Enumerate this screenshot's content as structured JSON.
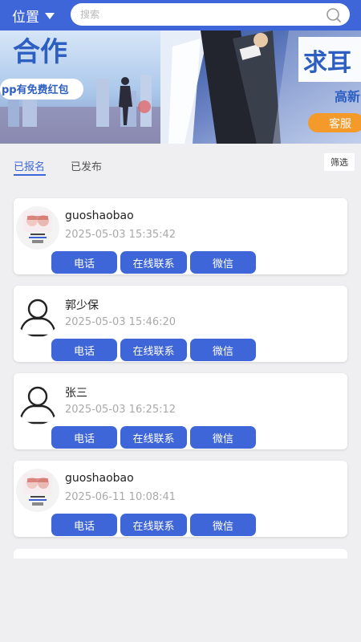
{
  "header": {
    "location_label": "位置",
    "search_placeholder": "搜索",
    "colors": {
      "primary": "#3f66d8"
    }
  },
  "banner": {
    "left_title": "合作",
    "left_subtitle": "pp有免费红包",
    "right_title": "求耳",
    "right_subtitle": "高新",
    "right_button": "客服"
  },
  "tabs": [
    {
      "label": "已报名",
      "active": true
    },
    {
      "label": "已发布",
      "active": false
    }
  ],
  "filter_label": "筛选",
  "cards": [
    {
      "name": "guoshaobao",
      "time": "2025-05-03 15:35:42",
      "avatar": "cake"
    },
    {
      "name": "郭少保",
      "time": "2025-05-03 15:46:20",
      "avatar": "person"
    },
    {
      "name": "张三",
      "time": "2025-05-03 16:25:12",
      "avatar": "person"
    },
    {
      "name": "guoshaobao",
      "time": "2025-06-11 10:08:41",
      "avatar": "cake"
    }
  ],
  "card_buttons": {
    "phone": "电话",
    "online": "在线联系",
    "wechat": "微信"
  }
}
